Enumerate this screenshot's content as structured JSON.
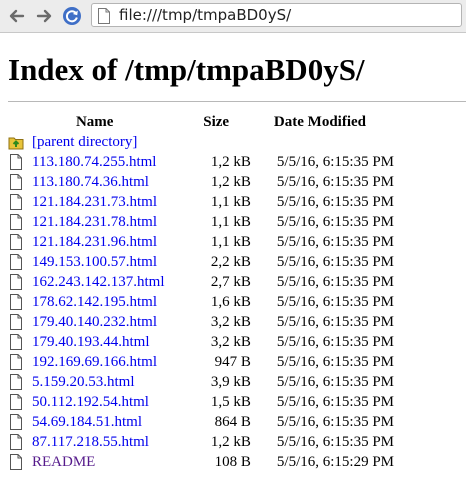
{
  "browser": {
    "url": "file:///tmp/tmpaBD0yS/",
    "back_icon": "arrow-left-icon",
    "forward_icon": "arrow-right-icon",
    "reload_icon": "reload-icon",
    "page_icon": "document-icon"
  },
  "page": {
    "title": "Index of /tmp/tmpaBD0yS/"
  },
  "listing": {
    "headers": {
      "name": "Name",
      "size": "Size",
      "modified": "Date Modified"
    },
    "parent_label": "[parent directory]",
    "files": [
      {
        "name": "113.180.74.255.html",
        "size": "1,2 kB",
        "modified": "5/5/16, 6:15:35 PM"
      },
      {
        "name": "113.180.74.36.html",
        "size": "1,2 kB",
        "modified": "5/5/16, 6:15:35 PM"
      },
      {
        "name": "121.184.231.73.html",
        "size": "1,1 kB",
        "modified": "5/5/16, 6:15:35 PM"
      },
      {
        "name": "121.184.231.78.html",
        "size": "1,1 kB",
        "modified": "5/5/16, 6:15:35 PM"
      },
      {
        "name": "121.184.231.96.html",
        "size": "1,1 kB",
        "modified": "5/5/16, 6:15:35 PM"
      },
      {
        "name": "149.153.100.57.html",
        "size": "2,2 kB",
        "modified": "5/5/16, 6:15:35 PM"
      },
      {
        "name": "162.243.142.137.html",
        "size": "2,7 kB",
        "modified": "5/5/16, 6:15:35 PM"
      },
      {
        "name": "178.62.142.195.html",
        "size": "1,6 kB",
        "modified": "5/5/16, 6:15:35 PM"
      },
      {
        "name": "179.40.140.232.html",
        "size": "3,2 kB",
        "modified": "5/5/16, 6:15:35 PM"
      },
      {
        "name": "179.40.193.44.html",
        "size": "3,2 kB",
        "modified": "5/5/16, 6:15:35 PM"
      },
      {
        "name": "192.169.69.166.html",
        "size": "947 B",
        "modified": "5/5/16, 6:15:35 PM"
      },
      {
        "name": "5.159.20.53.html",
        "size": "3,9 kB",
        "modified": "5/5/16, 6:15:35 PM"
      },
      {
        "name": "50.112.192.54.html",
        "size": "1,5 kB",
        "modified": "5/5/16, 6:15:35 PM"
      },
      {
        "name": "54.69.184.51.html",
        "size": "864 B",
        "modified": "5/5/16, 6:15:35 PM"
      },
      {
        "name": "87.117.218.55.html",
        "size": "1,2 kB",
        "modified": "5/5/16, 6:15:35 PM"
      },
      {
        "name": "README",
        "size": "108 B",
        "modified": "5/5/16, 6:15:29 PM"
      }
    ],
    "link_color": "#0000ee",
    "visited_color": "#551a8b"
  }
}
